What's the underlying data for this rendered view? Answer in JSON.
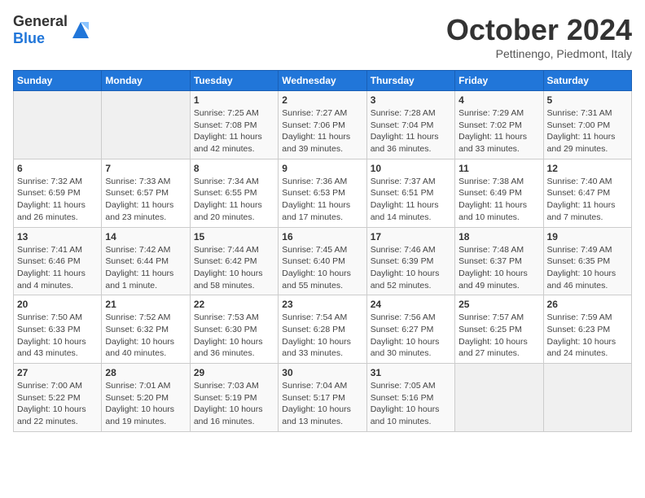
{
  "header": {
    "logo_general": "General",
    "logo_blue": "Blue",
    "title": "October 2024",
    "subtitle": "Pettinengo, Piedmont, Italy"
  },
  "weekdays": [
    "Sunday",
    "Monday",
    "Tuesday",
    "Wednesday",
    "Thursday",
    "Friday",
    "Saturday"
  ],
  "weeks": [
    [
      {
        "day": "",
        "info": ""
      },
      {
        "day": "",
        "info": ""
      },
      {
        "day": "1",
        "info": "Sunrise: 7:25 AM\nSunset: 7:08 PM\nDaylight: 11 hours and 42 minutes."
      },
      {
        "day": "2",
        "info": "Sunrise: 7:27 AM\nSunset: 7:06 PM\nDaylight: 11 hours and 39 minutes."
      },
      {
        "day": "3",
        "info": "Sunrise: 7:28 AM\nSunset: 7:04 PM\nDaylight: 11 hours and 36 minutes."
      },
      {
        "day": "4",
        "info": "Sunrise: 7:29 AM\nSunset: 7:02 PM\nDaylight: 11 hours and 33 minutes."
      },
      {
        "day": "5",
        "info": "Sunrise: 7:31 AM\nSunset: 7:00 PM\nDaylight: 11 hours and 29 minutes."
      }
    ],
    [
      {
        "day": "6",
        "info": "Sunrise: 7:32 AM\nSunset: 6:59 PM\nDaylight: 11 hours and 26 minutes."
      },
      {
        "day": "7",
        "info": "Sunrise: 7:33 AM\nSunset: 6:57 PM\nDaylight: 11 hours and 23 minutes."
      },
      {
        "day": "8",
        "info": "Sunrise: 7:34 AM\nSunset: 6:55 PM\nDaylight: 11 hours and 20 minutes."
      },
      {
        "day": "9",
        "info": "Sunrise: 7:36 AM\nSunset: 6:53 PM\nDaylight: 11 hours and 17 minutes."
      },
      {
        "day": "10",
        "info": "Sunrise: 7:37 AM\nSunset: 6:51 PM\nDaylight: 11 hours and 14 minutes."
      },
      {
        "day": "11",
        "info": "Sunrise: 7:38 AM\nSunset: 6:49 PM\nDaylight: 11 hours and 10 minutes."
      },
      {
        "day": "12",
        "info": "Sunrise: 7:40 AM\nSunset: 6:47 PM\nDaylight: 11 hours and 7 minutes."
      }
    ],
    [
      {
        "day": "13",
        "info": "Sunrise: 7:41 AM\nSunset: 6:46 PM\nDaylight: 11 hours and 4 minutes."
      },
      {
        "day": "14",
        "info": "Sunrise: 7:42 AM\nSunset: 6:44 PM\nDaylight: 11 hours and 1 minute."
      },
      {
        "day": "15",
        "info": "Sunrise: 7:44 AM\nSunset: 6:42 PM\nDaylight: 10 hours and 58 minutes."
      },
      {
        "day": "16",
        "info": "Sunrise: 7:45 AM\nSunset: 6:40 PM\nDaylight: 10 hours and 55 minutes."
      },
      {
        "day": "17",
        "info": "Sunrise: 7:46 AM\nSunset: 6:39 PM\nDaylight: 10 hours and 52 minutes."
      },
      {
        "day": "18",
        "info": "Sunrise: 7:48 AM\nSunset: 6:37 PM\nDaylight: 10 hours and 49 minutes."
      },
      {
        "day": "19",
        "info": "Sunrise: 7:49 AM\nSunset: 6:35 PM\nDaylight: 10 hours and 46 minutes."
      }
    ],
    [
      {
        "day": "20",
        "info": "Sunrise: 7:50 AM\nSunset: 6:33 PM\nDaylight: 10 hours and 43 minutes."
      },
      {
        "day": "21",
        "info": "Sunrise: 7:52 AM\nSunset: 6:32 PM\nDaylight: 10 hours and 40 minutes."
      },
      {
        "day": "22",
        "info": "Sunrise: 7:53 AM\nSunset: 6:30 PM\nDaylight: 10 hours and 36 minutes."
      },
      {
        "day": "23",
        "info": "Sunrise: 7:54 AM\nSunset: 6:28 PM\nDaylight: 10 hours and 33 minutes."
      },
      {
        "day": "24",
        "info": "Sunrise: 7:56 AM\nSunset: 6:27 PM\nDaylight: 10 hours and 30 minutes."
      },
      {
        "day": "25",
        "info": "Sunrise: 7:57 AM\nSunset: 6:25 PM\nDaylight: 10 hours and 27 minutes."
      },
      {
        "day": "26",
        "info": "Sunrise: 7:59 AM\nSunset: 6:23 PM\nDaylight: 10 hours and 24 minutes."
      }
    ],
    [
      {
        "day": "27",
        "info": "Sunrise: 7:00 AM\nSunset: 5:22 PM\nDaylight: 10 hours and 22 minutes."
      },
      {
        "day": "28",
        "info": "Sunrise: 7:01 AM\nSunset: 5:20 PM\nDaylight: 10 hours and 19 minutes."
      },
      {
        "day": "29",
        "info": "Sunrise: 7:03 AM\nSunset: 5:19 PM\nDaylight: 10 hours and 16 minutes."
      },
      {
        "day": "30",
        "info": "Sunrise: 7:04 AM\nSunset: 5:17 PM\nDaylight: 10 hours and 13 minutes."
      },
      {
        "day": "31",
        "info": "Sunrise: 7:05 AM\nSunset: 5:16 PM\nDaylight: 10 hours and 10 minutes."
      },
      {
        "day": "",
        "info": ""
      },
      {
        "day": "",
        "info": ""
      }
    ]
  ]
}
